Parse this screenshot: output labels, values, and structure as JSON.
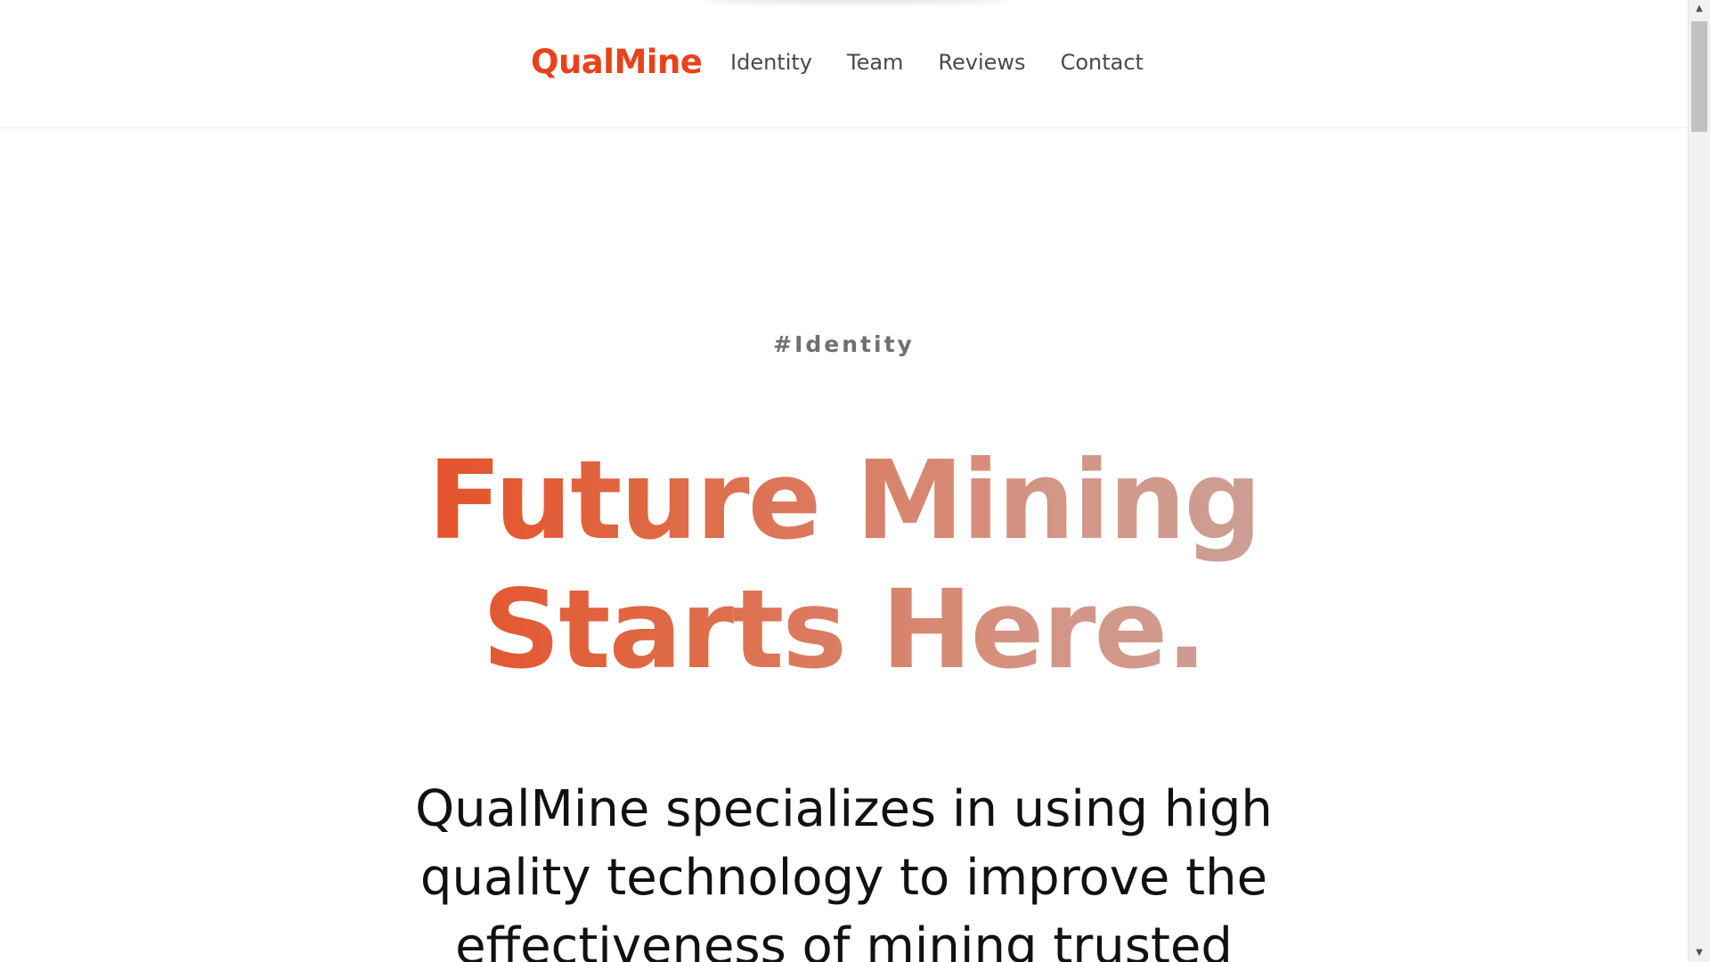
{
  "colors": {
    "brand": "#e8421a",
    "nav_text": "#4a4a4a",
    "tag_text": "#707070",
    "body_text": "#111111",
    "gradient_start": "#e8441c",
    "gradient_end": "#c7a49e"
  },
  "header": {
    "brand": "QualMine",
    "nav": [
      {
        "label": "Identity"
      },
      {
        "label": "Team"
      },
      {
        "label": "Reviews"
      },
      {
        "label": "Contact"
      }
    ]
  },
  "hero": {
    "tag": "#Identity",
    "title": "Future Mining Starts Here.",
    "description": "QualMine specializes in using high quality technology to improve the effectiveness of mining trusted"
  },
  "scrollbar": {
    "up_icon": "arrow-up-icon",
    "down_icon": "arrow-down-icon"
  }
}
